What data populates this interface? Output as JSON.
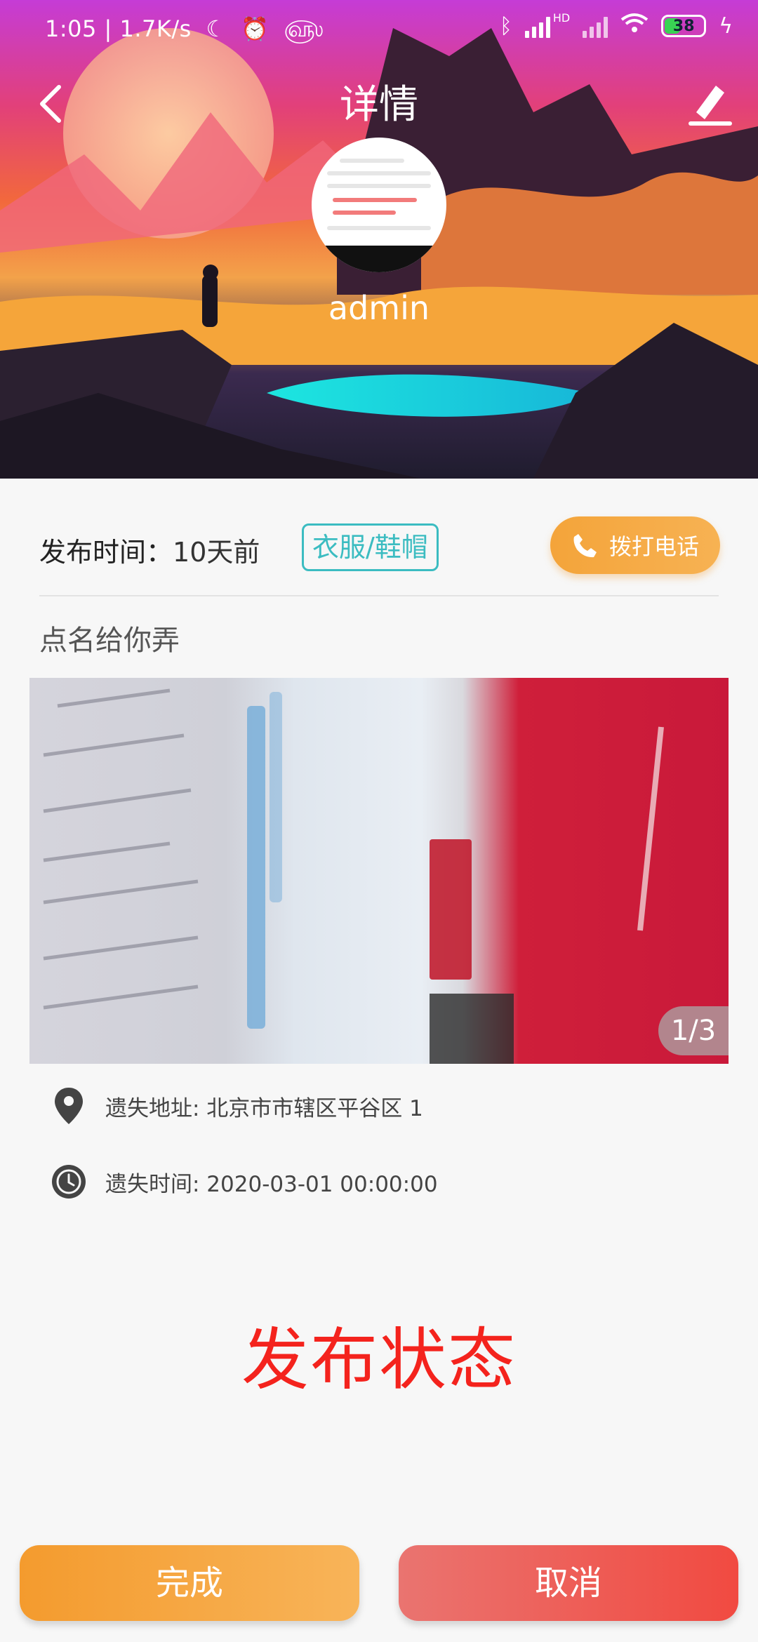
{
  "status_bar": {
    "time_speed": "1:05 | 1.7K/s",
    "network_badge": "HD",
    "battery": "38",
    "icons": [
      "moon-icon",
      "alarm-icon",
      "app-icon",
      "bluetooth-icon",
      "signal-icon",
      "wifi-icon",
      "battery-icon",
      "charging-icon"
    ]
  },
  "header": {
    "title": "详情",
    "username": "admin",
    "back_icon": "chevron-left-icon",
    "edit_icon": "edit-icon"
  },
  "info": {
    "publish_label": "发布时间：",
    "publish_value": "10天前",
    "category": "衣服/鞋帽",
    "call_label": "拨打电话",
    "item_title": "点名给你弄"
  },
  "gallery": {
    "indicator": "1/3",
    "current": 1,
    "total": 3
  },
  "details": {
    "address_label": "遗失地址: 北京市市辖区平谷区 1",
    "time_label": "遗失时间: 2020-03-01 00:00:00"
  },
  "status_heading": "发布状态",
  "actions": {
    "done": "完成",
    "cancel": "取消"
  },
  "colors": {
    "tag_color": "#3bbcc1",
    "call_button": "#f4a43a",
    "status_red": "#f4231d",
    "done_button": "#f49b2e",
    "cancel_button": "#ef5b52"
  }
}
